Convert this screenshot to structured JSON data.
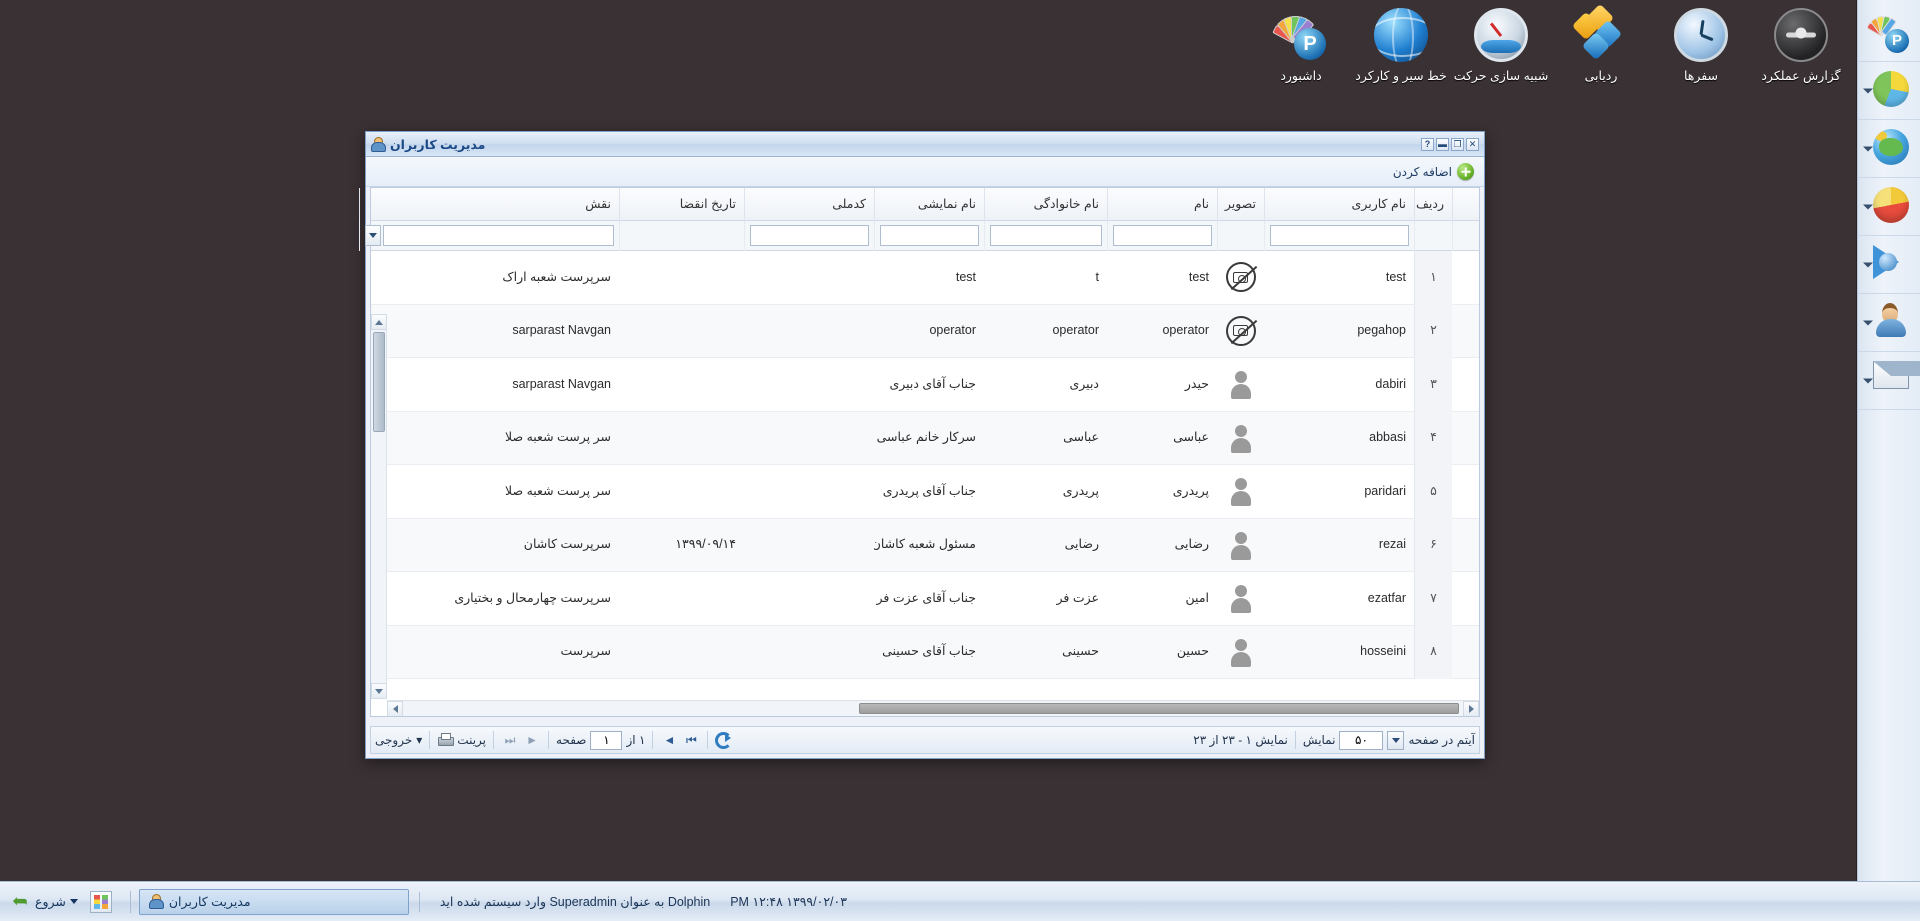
{
  "top_toolbar": {
    "items": [
      {
        "label": "داشبورد",
        "icon": "dashboard-icon"
      },
      {
        "label": "خط سیر و کارکرد",
        "icon": "route-globe-icon"
      },
      {
        "label": "شبیه سازی حرکت",
        "icon": "motion-simulation-gauge-icon"
      },
      {
        "label": "ردیابی",
        "icon": "tracking-blocks-icon"
      },
      {
        "label": "سفرها",
        "icon": "trips-clock-icon"
      },
      {
        "label": "گزارش عملکرد",
        "icon": "performance-report-wheel-icon"
      }
    ]
  },
  "right_bar": {
    "items": [
      {
        "icon": "dashboard-icon",
        "has_caret": false
      },
      {
        "icon": "pie-chart-3d-icon",
        "has_caret": true
      },
      {
        "icon": "globe-map-icon",
        "has_caret": true
      },
      {
        "icon": "pie-report-icon",
        "has_caret": true
      },
      {
        "icon": "play-media-icon",
        "has_caret": true
      },
      {
        "icon": "user-admin-icon",
        "has_caret": true
      },
      {
        "icon": "message-envelope-icon",
        "has_caret": true
      }
    ]
  },
  "window": {
    "title": "مدیریت کاربران",
    "title_icon": "user-manage-icon",
    "buttons": {
      "close": "✕",
      "maximize": "❐",
      "minimize": "▬",
      "help": "?"
    },
    "toolbar": {
      "add_label": "اضافه کردن",
      "add_icon": "green-plus-icon"
    }
  },
  "grid": {
    "columns": [
      {
        "key": "num",
        "label": "ردیف"
      },
      {
        "key": "user",
        "label": "نام کاربری"
      },
      {
        "key": "img",
        "label": "تصویر"
      },
      {
        "key": "name",
        "label": "نام"
      },
      {
        "key": "fam",
        "label": "نام خانوادگی"
      },
      {
        "key": "disp",
        "label": "نام نمایشی"
      },
      {
        "key": "nid",
        "label": "کدملی"
      },
      {
        "key": "exp",
        "label": "تاریخ انقضا"
      },
      {
        "key": "role",
        "label": "نقش"
      }
    ],
    "filters": {
      "user": "",
      "name": "",
      "fam": "",
      "disp": "",
      "nid": "",
      "role": ""
    },
    "rows": [
      {
        "num": "۱",
        "user": "test",
        "avatar": "no-photo",
        "name": "test",
        "fam": "t",
        "disp": "test",
        "nid": "",
        "exp": "",
        "role": "سرپرست شعبه اراک"
      },
      {
        "num": "۲",
        "user": "pegahop",
        "avatar": "no-photo",
        "name": "operator",
        "fam": "operator",
        "disp": "operator",
        "nid": "",
        "exp": "",
        "role": "sarparast Navgan"
      },
      {
        "num": "۳",
        "user": "dabiri",
        "avatar": "person",
        "name": "حیدر",
        "fam": "دبیری",
        "disp": "جناب آقای دبیری",
        "nid": "",
        "exp": "",
        "role": "sarparast Navgan"
      },
      {
        "num": "۴",
        "user": "abbasi",
        "avatar": "person",
        "name": "عباسی",
        "fam": "عباسی",
        "disp": "سرکار خانم عباسی",
        "nid": "",
        "exp": "",
        "role": "سر پرست شعبه صلا"
      },
      {
        "num": "۵",
        "user": "paridari",
        "avatar": "person",
        "name": "پریدری",
        "fam": "پریدری",
        "disp": "جناب آقای پریدری",
        "nid": "",
        "exp": "",
        "role": "سر پرست شعبه صلا"
      },
      {
        "num": "۶",
        "user": "rezai",
        "avatar": "person",
        "name": "رضایی",
        "fam": "رضایی",
        "disp": "مسئول شعبه کاشان",
        "nid": "",
        "exp": "۱۳۹۹/۰۹/۱۴",
        "role": "سرپرست کاشان"
      },
      {
        "num": "۷",
        "user": "ezatfar",
        "avatar": "person",
        "name": "امین",
        "fam": "عزت فر",
        "disp": "جناب آقای عزت فر",
        "nid": "",
        "exp": "",
        "role": "سرپرست چهارمحال و بختیاری"
      },
      {
        "num": "۸",
        "user": "hosseini",
        "avatar": "person",
        "name": "حسین",
        "fam": "حسینی",
        "disp": "جناب آقای حسینی",
        "nid": "",
        "exp": "",
        "role": "سرپرست"
      }
    ]
  },
  "pager": {
    "export_label": "خروجی",
    "export_caret": "▾",
    "print_label": "پرینت",
    "print_icon": "printer-icon",
    "first_icon": "⏮",
    "prev_icon": "◄",
    "next_icon": "►",
    "last_icon": "⏭",
    "page_label": "صفحه",
    "page_value": "۱",
    "of_label": "۱ از",
    "refresh_icon": "refresh-icon",
    "showing_label": "نمایش ۱ - ۲۳ از ۲۳",
    "page_size_label": "نمایش",
    "page_size_value": "۵۰",
    "per_page_label": "آیتم در صفحه"
  },
  "taskbar": {
    "start_label": "شروع",
    "start_caret": "▾",
    "quick_launch_icon": "dashboard-quicklaunch-icon",
    "task_item": {
      "label": "مدیریت کاربران",
      "icon": "user-manage-icon"
    },
    "status_text": "Dolphin به عنوان Superadmin وارد سیستم شده اید",
    "datetime": "۱۳۹۹/۰۲/۰۳ ۱۲:۴۸ PM"
  }
}
